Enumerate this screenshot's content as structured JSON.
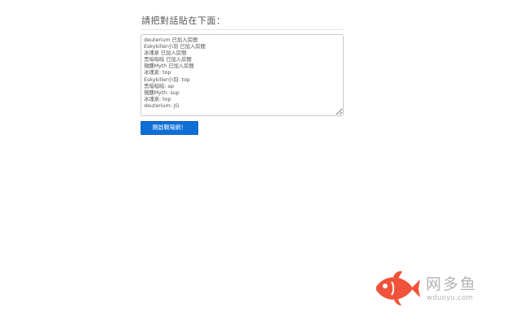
{
  "form": {
    "title": "請把對話貼在下面：",
    "chat_lines": [
      "deuterium 已加入房間",
      "Eskykiller小羽 已加入房間",
      "冰魂泉 已加入房間",
      "黑暗暗暗 已加入房間",
      "微醺Myth 已加入房間",
      "冰魂泉: top",
      "Eskykiller小羽: top",
      "黑暗暗暗: ap",
      "微醺Myth: sup",
      "冰魂泉: top",
      "deuterium: JG"
    ],
    "start_button_label": "開啟戰場網！"
  },
  "watermark": {
    "name": "网多鱼",
    "url": "wduoyu.com",
    "logo_color": "#f0533a"
  }
}
